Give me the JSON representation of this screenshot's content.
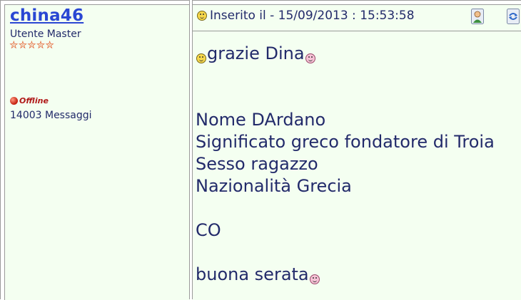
{
  "author": {
    "username": "china46",
    "rank": "Utente Master",
    "stars": 5,
    "status": "Offline",
    "message_count": "14003 Messaggi"
  },
  "post": {
    "posted_label": "Inserito il - 15/09/2013 : 15:53:58",
    "greeting": "grazie Dina",
    "lines": {
      "l1": "Nome DArdano",
      "l2": "Significato greco fondatore di Troia",
      "l3": "Sesso ragazzo",
      "l4": "Nazionalità Grecia",
      "l5": "CO",
      "l6": "buona serata"
    }
  },
  "icons": {
    "profile": "user-profile-icon",
    "quote": "quote-reply-icon"
  },
  "colors": {
    "panel_bg": "#f4fff1",
    "username": "#2a47d3",
    "text": "#222a6a",
    "offline_text": "#b01818",
    "stars": "#e46a3c"
  }
}
